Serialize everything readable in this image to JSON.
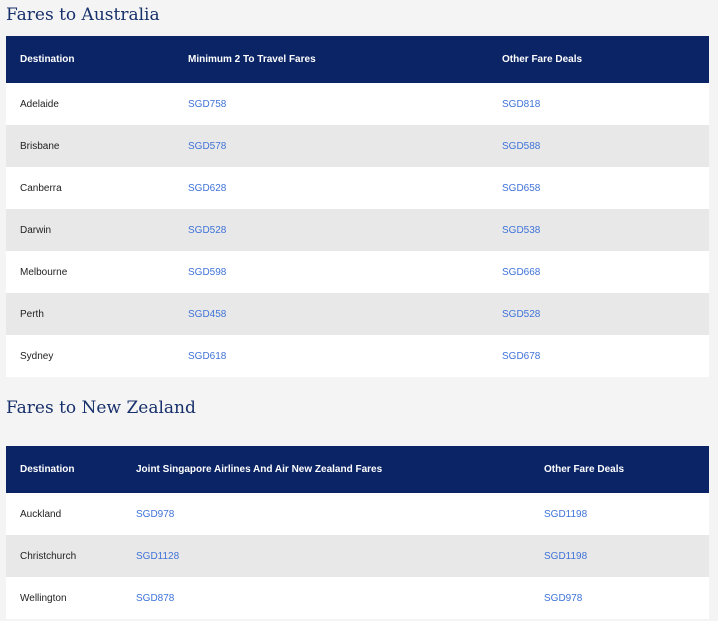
{
  "australia": {
    "title": "Fares to Australia",
    "headers": [
      "Destination",
      "Minimum 2 To Travel Fares",
      "Other Fare Deals"
    ],
    "rows": [
      {
        "destination": "Adelaide",
        "fare1": "SGD758",
        "fare2": "SGD818"
      },
      {
        "destination": "Brisbane",
        "fare1": "SGD578",
        "fare2": "SGD588"
      },
      {
        "destination": "Canberra",
        "fare1": "SGD628",
        "fare2": "SGD658"
      },
      {
        "destination": "Darwin",
        "fare1": "SGD528",
        "fare2": "SGD538"
      },
      {
        "destination": "Melbourne",
        "fare1": "SGD598",
        "fare2": "SGD668"
      },
      {
        "destination": "Perth",
        "fare1": "SGD458",
        "fare2": "SGD528"
      },
      {
        "destination": "Sydney",
        "fare1": "SGD618",
        "fare2": "SGD678"
      }
    ]
  },
  "newzealand": {
    "title": "Fares to New Zealand",
    "headers": [
      "Destination",
      "Joint Singapore Airlines And Air New Zealand Fares",
      "Other Fare Deals"
    ],
    "rows": [
      {
        "destination": "Auckland",
        "fare1": "SGD978",
        "fare2": "SGD1198"
      },
      {
        "destination": "Christchurch",
        "fare1": "SGD1128",
        "fare2": "SGD1198"
      },
      {
        "destination": "Wellington",
        "fare1": "SGD878",
        "fare2": "SGD978"
      }
    ]
  }
}
